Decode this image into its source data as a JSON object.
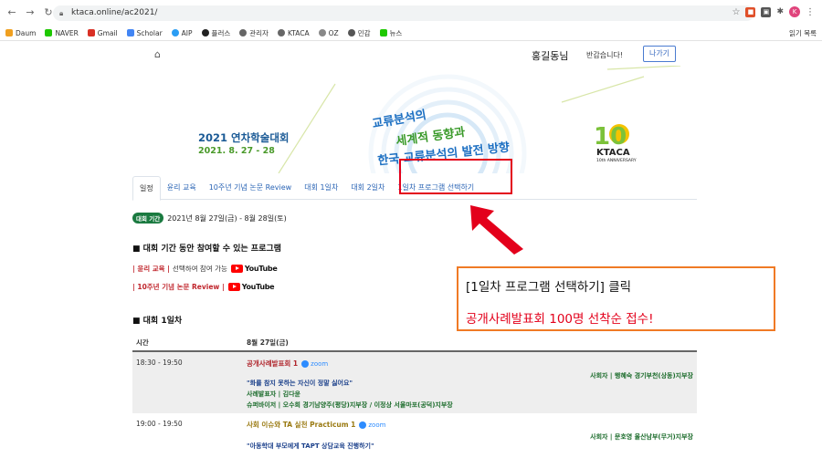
{
  "browser": {
    "url": "ktaca.online/ac2021/",
    "bookmarks": [
      "Daum",
      "NAVER",
      "Gmail",
      "Scholar",
      "AIP",
      "플러스",
      "관리자",
      "KTACA",
      "OZ",
      "민감",
      "뉴스"
    ],
    "bookmarks_right": "읽기 목록",
    "avatar_initial": "K"
  },
  "header": {
    "user_name": "홍길동님",
    "greeting": "반갑습니다!",
    "logout_label": "나가기"
  },
  "banner": {
    "conference_title": "2021 연차학술대회",
    "conference_dates": "2021. 8. 27 - 28",
    "slogan_line1": "교류분석의",
    "slogan_line2": "세계적 동향과",
    "slogan_line3": "한국 교류분석의 발전 방향",
    "logo_number": "10",
    "logo_name": "KTACA",
    "logo_sub": "10th ANNIVERSARY"
  },
  "tabs": [
    {
      "label": "일정",
      "active": true
    },
    {
      "label": "윤리 교육",
      "active": false
    },
    {
      "label": "10주년 기념 논문 Review",
      "active": false
    },
    {
      "label": "대회 1일차",
      "active": false
    },
    {
      "label": "대회 2일차",
      "active": false
    },
    {
      "label": "1일차 프로그램 선택하기",
      "active": false
    }
  ],
  "period": {
    "badge": "대회 기간",
    "text": "2021년 8월 27일(금) - 8월 28일(토)"
  },
  "programs_section": {
    "title": "■ 대회 기간 동안 참여할 수 있는 프로그램",
    "line1_red": "| 윤리 교육 |",
    "line1_text": "선택하여 참여 가능",
    "line2_red": "| 10주년 기념 논문 Review |",
    "youtube_label": "YouTube"
  },
  "day1_section": {
    "title": "■ 대회 1일차",
    "col_time": "시간",
    "col_date": "8월 27일(금)",
    "rows": [
      {
        "time": "18:30 - 19:50",
        "title": "공개사례발표회 1",
        "title_color": "#b0262d",
        "zoom": "zoom",
        "moderator": "사회자 | 행혜숙 경기부천(상동)지부장",
        "topic": "\"화를 참지 못하는 자신이 정말 싫어요\"",
        "presenter": "사례발표자 | 김다윤",
        "supervisors": "슈퍼바이저 | 오수희 경기남양주(평당)지부장 / 이정상 서울마포(공덕)지부장"
      },
      {
        "time": "19:00 - 19:50",
        "title": "사회 이슈와 TA 실천 Practicum 1",
        "title_color": "#9a7a12",
        "zoom": "zoom",
        "moderator": "사회자 | 문호영 울산남부(무거)지부장",
        "topic": "\"아동학대 부모에게 TAPT 상담교육 진행하기\""
      }
    ]
  },
  "annotation": {
    "callout_line1": "[1일차 프로그램 선택하기] 클릭",
    "callout_line2": "공개사례발표회 100명 선착순 접수!",
    "box_color": "#e3001b",
    "callout_border": "#f07a25"
  }
}
